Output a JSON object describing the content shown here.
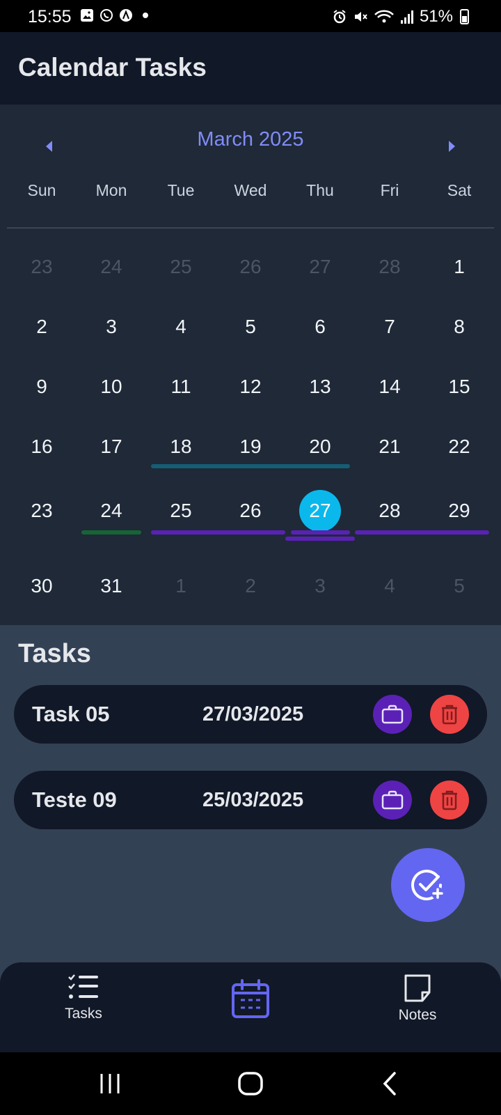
{
  "status_bar": {
    "time": "15:55",
    "battery": "51%",
    "left_icons": [
      "image-icon",
      "whatsapp-icon",
      "app-icon",
      "dot-icon"
    ],
    "right_icons": [
      "alarm-icon",
      "mute-icon",
      "wifi-icon",
      "signal-icon",
      "battery-icon"
    ]
  },
  "app": {
    "title": "Calendar Tasks"
  },
  "calendar": {
    "month_label": "March 2025",
    "weekdays": [
      "Sun",
      "Mon",
      "Tue",
      "Wed",
      "Thu",
      "Fri",
      "Sat"
    ],
    "weeks": [
      [
        {
          "d": "23",
          "m": true
        },
        {
          "d": "24",
          "m": true
        },
        {
          "d": "25",
          "m": true
        },
        {
          "d": "26",
          "m": true
        },
        {
          "d": "27",
          "m": true
        },
        {
          "d": "28",
          "m": true
        },
        {
          "d": "1"
        }
      ],
      [
        {
          "d": "2"
        },
        {
          "d": "3"
        },
        {
          "d": "4"
        },
        {
          "d": "5"
        },
        {
          "d": "6"
        },
        {
          "d": "7"
        },
        {
          "d": "8"
        }
      ],
      [
        {
          "d": "9"
        },
        {
          "d": "10"
        },
        {
          "d": "11"
        },
        {
          "d": "12"
        },
        {
          "d": "13"
        },
        {
          "d": "14"
        },
        {
          "d": "15"
        }
      ],
      [
        {
          "d": "16"
        },
        {
          "d": "17"
        },
        {
          "d": "18"
        },
        {
          "d": "19"
        },
        {
          "d": "20"
        },
        {
          "d": "21"
        },
        {
          "d": "22"
        }
      ],
      [
        {
          "d": "23"
        },
        {
          "d": "24"
        },
        {
          "d": "25"
        },
        {
          "d": "26"
        },
        {
          "d": "27",
          "selected": true
        },
        {
          "d": "28"
        },
        {
          "d": "29"
        }
      ],
      [
        {
          "d": "30"
        },
        {
          "d": "31"
        },
        {
          "d": "1",
          "m": true
        },
        {
          "d": "2",
          "m": true
        },
        {
          "d": "3",
          "m": true
        },
        {
          "d": "4",
          "m": true
        },
        {
          "d": "5",
          "m": true
        }
      ]
    ],
    "colors": {
      "accent": "#818cf8",
      "selected": "#0bb8ec",
      "teal_event": "#155e75",
      "green_event": "#166534",
      "purple_event": "#5b21b6"
    }
  },
  "tasks": {
    "heading": "Tasks",
    "items": [
      {
        "name": "Task 05",
        "date": "27/03/2025"
      },
      {
        "name": "Teste 09",
        "date": "25/03/2025"
      }
    ]
  },
  "bottom_nav": {
    "tasks_label": "Tasks",
    "notes_label": "Notes",
    "active": "calendar"
  }
}
